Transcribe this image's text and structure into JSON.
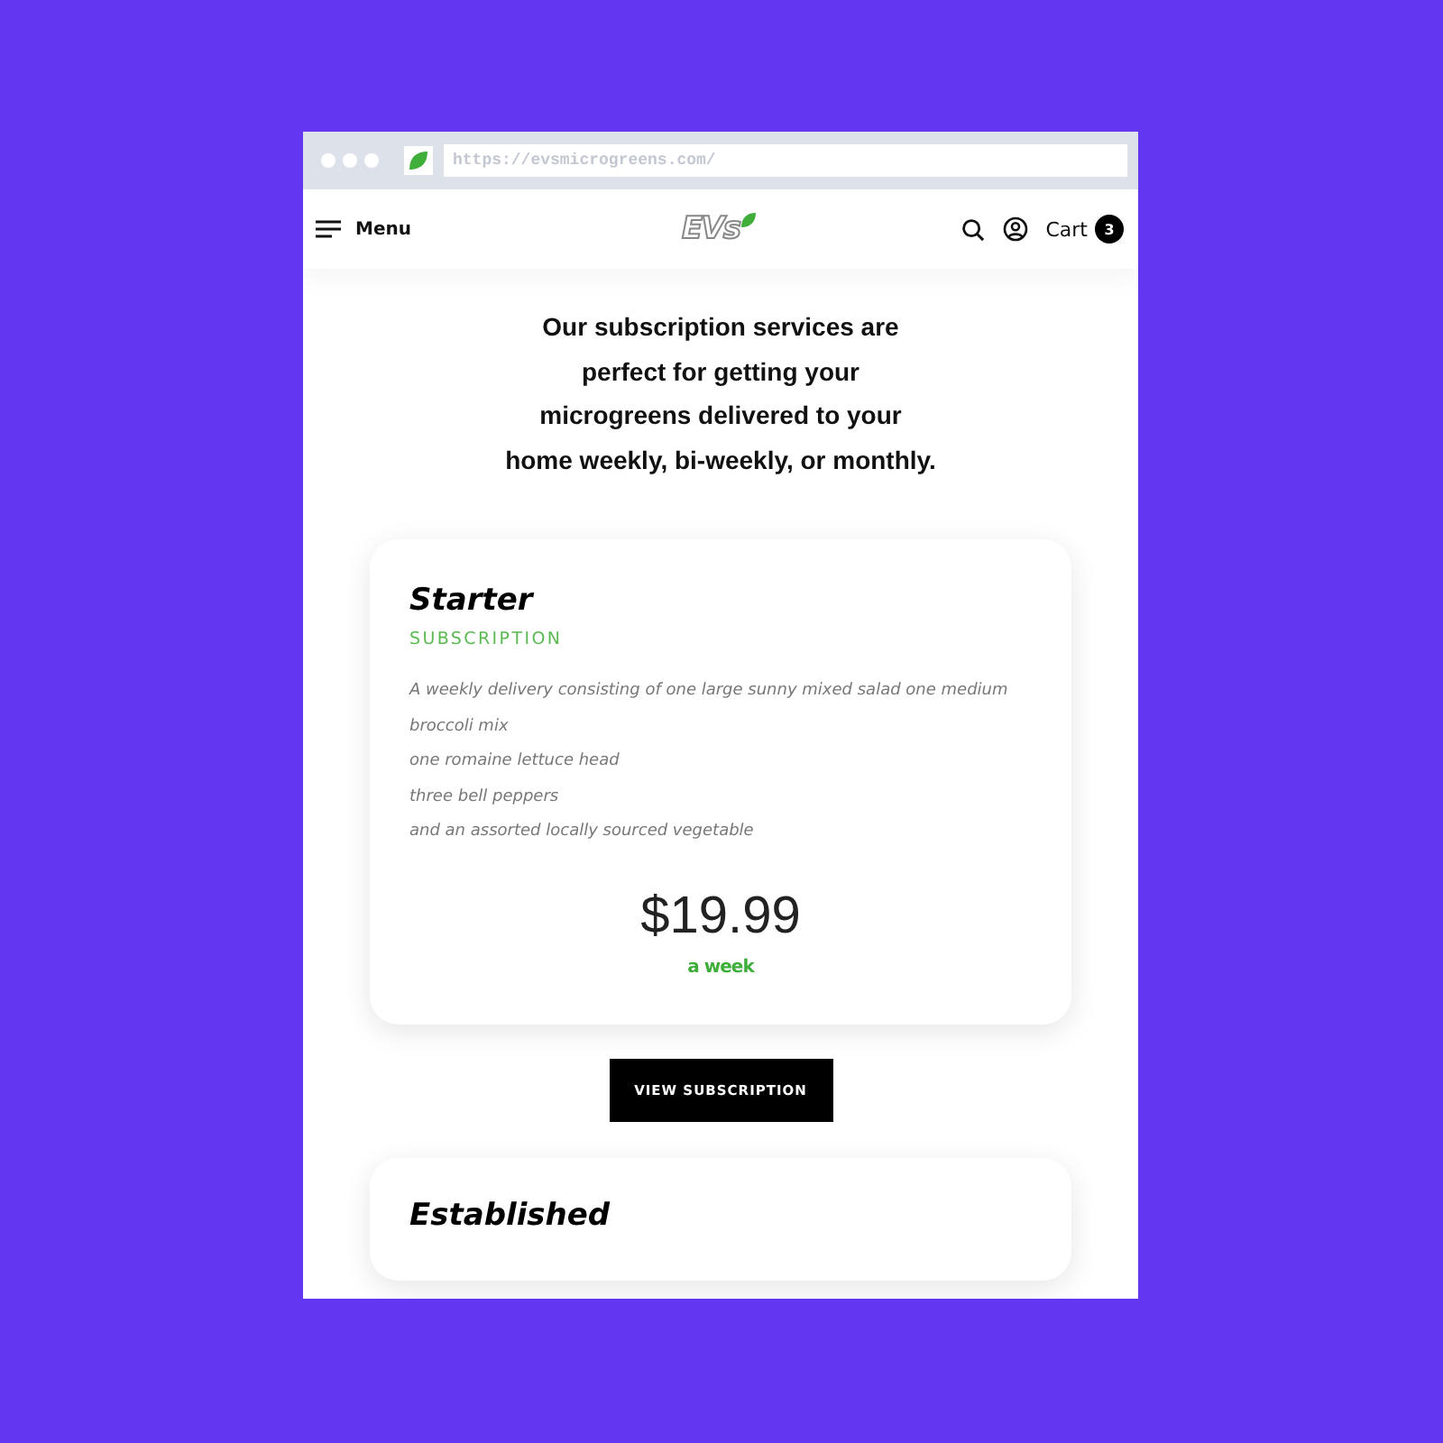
{
  "browser": {
    "url": "https://evsmicrogreens.com/"
  },
  "header": {
    "menu_label": "Menu",
    "logo": "EVs",
    "cart_label": "Cart",
    "cart_count": "3"
  },
  "intro": "Our subscription services are perfect for getting your microgreens delivered to your home weekly, bi-weekly, or monthly.",
  "plans": [
    {
      "title": "Starter",
      "subtitle": "SUBSCRIPTION",
      "description": [
        "A weekly delivery consisting of one large sunny mixed salad one medium",
        "broccoli mix",
        "one romaine lettuce head",
        "three bell peppers",
        "and an assorted locally sourced vegetable"
      ],
      "price": "$19.99",
      "period": "a week",
      "button": "VIEW SUBSCRIPTION"
    },
    {
      "title": "Established"
    }
  ]
}
